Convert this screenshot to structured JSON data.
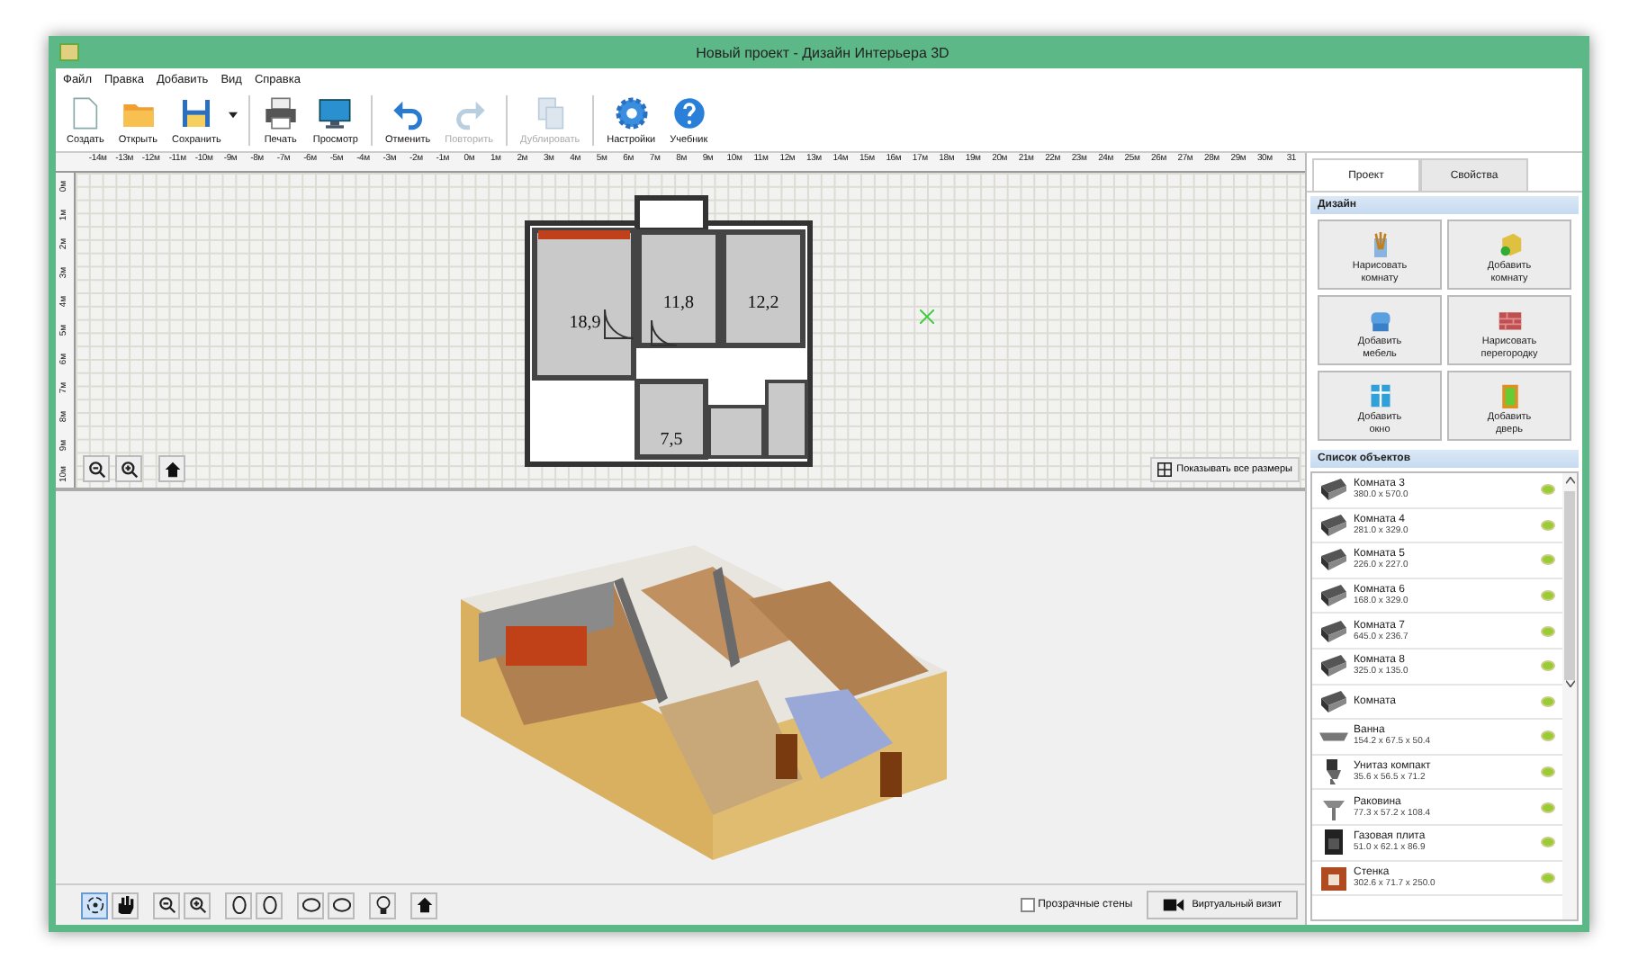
{
  "window": {
    "title": "Новый проект - Дизайн Интерьера 3D"
  },
  "menu": [
    "Файл",
    "Правка",
    "Добавить",
    "Вид",
    "Справка"
  ],
  "toolbar": [
    [
      {
        "kind": "new",
        "label": "Создать",
        "disabled": false
      },
      {
        "kind": "open",
        "label": "Открыть",
        "disabled": false
      },
      {
        "kind": "save",
        "label": "Сохранить",
        "disabled": false,
        "dropdown": true
      }
    ],
    [
      {
        "kind": "print",
        "label": "Печать",
        "disabled": false
      },
      {
        "kind": "preview",
        "label": "Просмотр",
        "disabled": false
      }
    ],
    [
      {
        "kind": "undo",
        "label": "Отменить",
        "disabled": false
      },
      {
        "kind": "redo",
        "label": "Повторить",
        "disabled": true
      }
    ],
    [
      {
        "kind": "copy",
        "label": "Дублировать",
        "disabled": true
      }
    ],
    [
      {
        "kind": "settings",
        "label": "Настройки",
        "disabled": false
      },
      {
        "kind": "help",
        "label": "Учебник",
        "disabled": false
      }
    ]
  ],
  "ruler": {
    "horizontal": [
      "-14м",
      "-13м",
      "-12м",
      "-11м",
      "-10м",
      "-9м",
      "-8м",
      "-7м",
      "-6м",
      "-5м",
      "-4м",
      "-3м",
      "-2м",
      "-1м",
      "0м",
      "1м",
      "2м",
      "3м",
      "4м",
      "5м",
      "6м",
      "7м",
      "8м",
      "9м",
      "10м",
      "11м",
      "12м",
      "13м",
      "14м",
      "15м",
      "16м",
      "17м",
      "18м",
      "19м",
      "20м",
      "21м",
      "22м",
      "23м",
      "24м",
      "25м",
      "26м",
      "27м",
      "28м",
      "29м",
      "30м",
      "31"
    ],
    "vertical": [
      "0м",
      "1м",
      "2м",
      "3м",
      "4м",
      "5м",
      "6м",
      "7м",
      "8м",
      "9м",
      "10м"
    ]
  },
  "plan": {
    "rooms": [
      {
        "area": "18,9"
      },
      {
        "area": "11,8"
      },
      {
        "area": "12,2"
      },
      {
        "area": "7,5"
      }
    ],
    "show_all_sizes": "Показывать все размеры"
  },
  "view3d_toolbar": [
    {
      "kind": "rotate",
      "selected": true
    },
    {
      "kind": "pan",
      "selected": false
    },
    {
      "kind": "zoom-out",
      "selected": false
    },
    {
      "kind": "zoom-in",
      "selected": false
    },
    {
      "kind": "turn-left",
      "selected": false
    },
    {
      "kind": "turn-right",
      "selected": false
    },
    {
      "kind": "tilt-up",
      "selected": false
    },
    {
      "kind": "tilt-down",
      "selected": false
    },
    {
      "kind": "light",
      "selected": false
    },
    {
      "kind": "home",
      "selected": false
    }
  ],
  "transparent_walls": {
    "label": "Прозрачные стены",
    "checked": false
  },
  "virtual_visit": "Виртуальный визит",
  "tabs": [
    {
      "label": "Проект",
      "selected": true
    },
    {
      "label": "Свойства",
      "selected": false
    }
  ],
  "design": {
    "title": "Дизайн",
    "buttons": [
      {
        "kind": "draw-room",
        "label": "Нарисовать комнату"
      },
      {
        "kind": "add-room",
        "label": "Добавить комнату"
      },
      {
        "kind": "furniture",
        "label": "Добавить мебель"
      },
      {
        "kind": "wall",
        "label": "Нарисовать перегородку"
      },
      {
        "kind": "window",
        "label": "Добавить окно"
      },
      {
        "kind": "door",
        "label": "Добавить дверь"
      }
    ]
  },
  "objects": {
    "title": "Список объектов",
    "items": [
      {
        "kind": "room",
        "name": "Комната 3",
        "size": "380.0 x 570.0",
        "visible": true
      },
      {
        "kind": "room",
        "name": "Комната 4",
        "size": "281.0 x 329.0",
        "visible": true
      },
      {
        "kind": "room",
        "name": "Комната 5",
        "size": "226.0 x 227.0",
        "visible": true
      },
      {
        "kind": "room",
        "name": "Комната 6",
        "size": "168.0 x 329.0",
        "visible": true
      },
      {
        "kind": "room",
        "name": "Комната 7",
        "size": "645.0 x 236.7",
        "visible": true
      },
      {
        "kind": "room",
        "name": "Комната 8",
        "size": "325.0 x 135.0",
        "visible": true
      },
      {
        "kind": "room",
        "name": "Комната",
        "visible": true
      },
      {
        "kind": "bath",
        "name": "Ванна",
        "size": "154.2 x 67.5 x 50.4",
        "visible": true
      },
      {
        "kind": "toilet",
        "name": "Унитаз компакт",
        "size": "35.6 x 56.5 x 71.2",
        "visible": true
      },
      {
        "kind": "sink",
        "name": "Раковина",
        "size": "77.3 x 57.2 x 108.4",
        "visible": true
      },
      {
        "kind": "stove",
        "name": "Газовая плита",
        "size": "51.0 x 62.1 x 86.9",
        "visible": true
      },
      {
        "kind": "cabinet",
        "name": "Стенка",
        "size": "302.6 x 71.7 x 250.0",
        "visible": true
      }
    ]
  }
}
